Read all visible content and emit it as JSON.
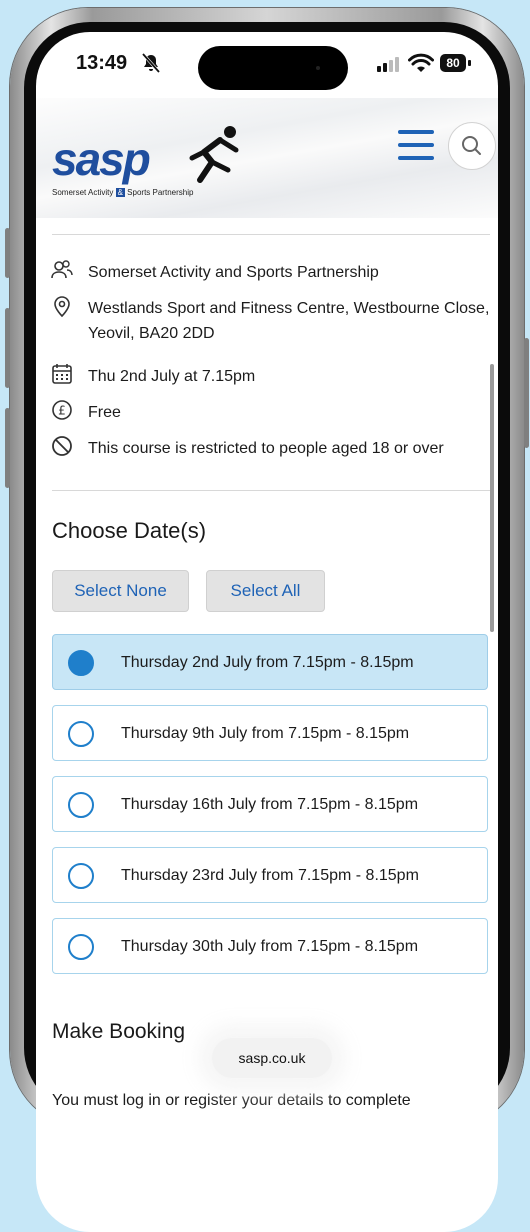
{
  "status_bar": {
    "time": "13:49",
    "battery": "80"
  },
  "header": {
    "logo_text": "sasp",
    "logo_subtitle_left": "Somerset Activity",
    "logo_subtitle_amp": "&",
    "logo_subtitle_right": "Sports Partnership",
    "brand_color": "#1f4e9e"
  },
  "details": {
    "organiser": "Somerset Activity and Sports Partnership",
    "location": "Westlands Sport and Fitness Centre, Westbourne Close, Yeovil, BA20 2DD",
    "date": "Thu 2nd July at 7.15pm",
    "price": "Free",
    "restriction": "This course is restricted to people aged 18 or over"
  },
  "choose_dates": {
    "heading": "Choose Date(s)",
    "select_none": "Select None",
    "select_all": "Select All",
    "options": [
      {
        "label": "Thursday 2nd July from 7.15pm - 8.15pm",
        "selected": true
      },
      {
        "label": "Thursday 9th July from 7.15pm - 8.15pm",
        "selected": false
      },
      {
        "label": "Thursday 16th July from 7.15pm - 8.15pm",
        "selected": false
      },
      {
        "label": "Thursday 23rd July from 7.15pm - 8.15pm",
        "selected": false
      },
      {
        "label": "Thursday 30th July from 7.15pm - 8.15pm",
        "selected": false
      }
    ]
  },
  "booking": {
    "heading": "Make Booking",
    "text": "You must log in or register your details to complete"
  },
  "browser": {
    "url": "sasp.co.uk"
  },
  "colors": {
    "accent": "#1f63b6",
    "radio": "#1f7fcb",
    "selected_row": "#c8e6f6",
    "background": "#c6e7f7"
  }
}
